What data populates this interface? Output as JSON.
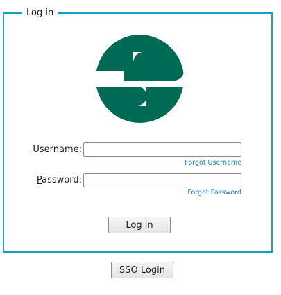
{
  "login_form": {
    "legend": "Log in",
    "username": {
      "label_accesskey": "U",
      "label_rest": "sername:",
      "value": "",
      "placeholder": ""
    },
    "password": {
      "label_accesskey": "P",
      "label_rest": "assword:",
      "value": "",
      "placeholder": ""
    },
    "forgot_username": "Forgot Username",
    "forgot_password": "Forgot Password",
    "login_button": "Log in"
  },
  "sso_button": "SSO Login",
  "logo": {
    "icon": "s-circle-logo",
    "color": "#006b54"
  },
  "colors": {
    "frame_border": "#1aa0c4",
    "link": "#1f86b8"
  }
}
